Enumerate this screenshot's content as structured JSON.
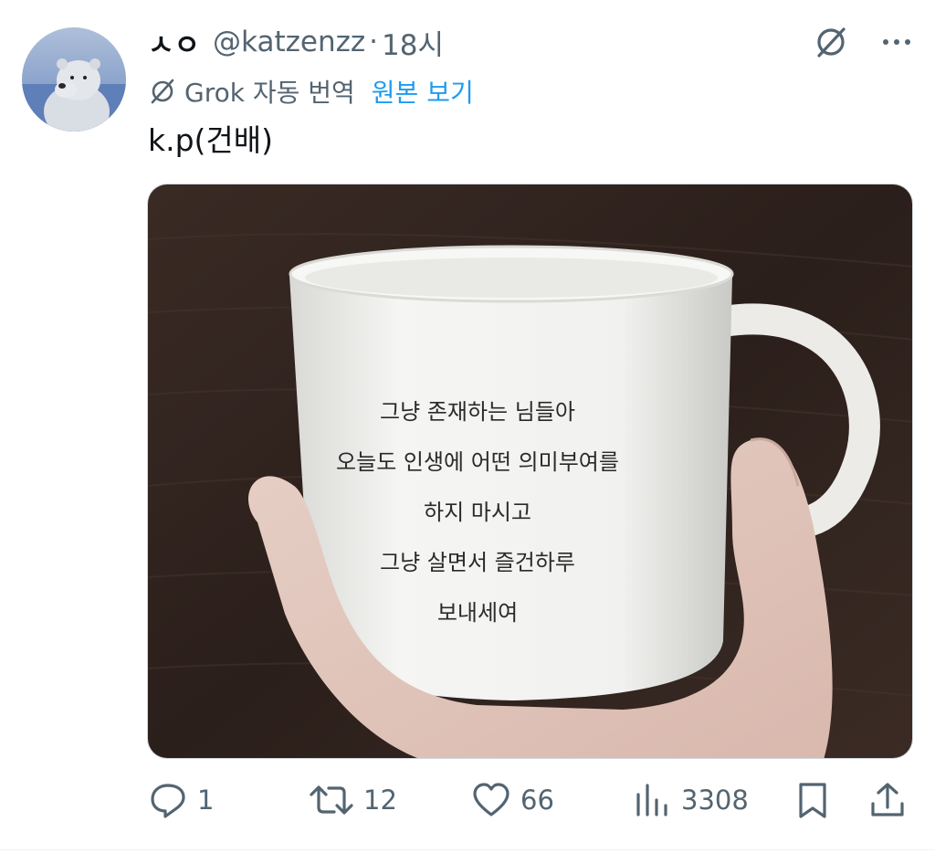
{
  "author": {
    "display_name": "ㅅㅇ",
    "handle": "@katzenzz",
    "separator": "·",
    "time": "18시"
  },
  "translation": {
    "label": "Grok 자동 번역",
    "show_original": "원본 보기"
  },
  "tweet": {
    "text": "k.p(건배)"
  },
  "media": {
    "mug_text": [
      "그냥 존재하는 님들아",
      "오늘도 인생에 어떤 의미부여를",
      "하지 마시고",
      "그냥 살면서 즐건하루",
      "보내세여"
    ]
  },
  "actions": {
    "replies": "1",
    "reposts": "12",
    "likes": "66",
    "views": "3308"
  },
  "icons": {
    "grok": "grok-icon",
    "more": "more-icon",
    "reply": "reply-icon",
    "repost": "repost-icon",
    "like": "heart-icon",
    "views": "views-icon",
    "bookmark": "bookmark-icon",
    "share": "share-icon"
  },
  "colors": {
    "accent": "#1d9bf0",
    "secondary_text": "#536471",
    "primary_text": "#0f1419"
  }
}
